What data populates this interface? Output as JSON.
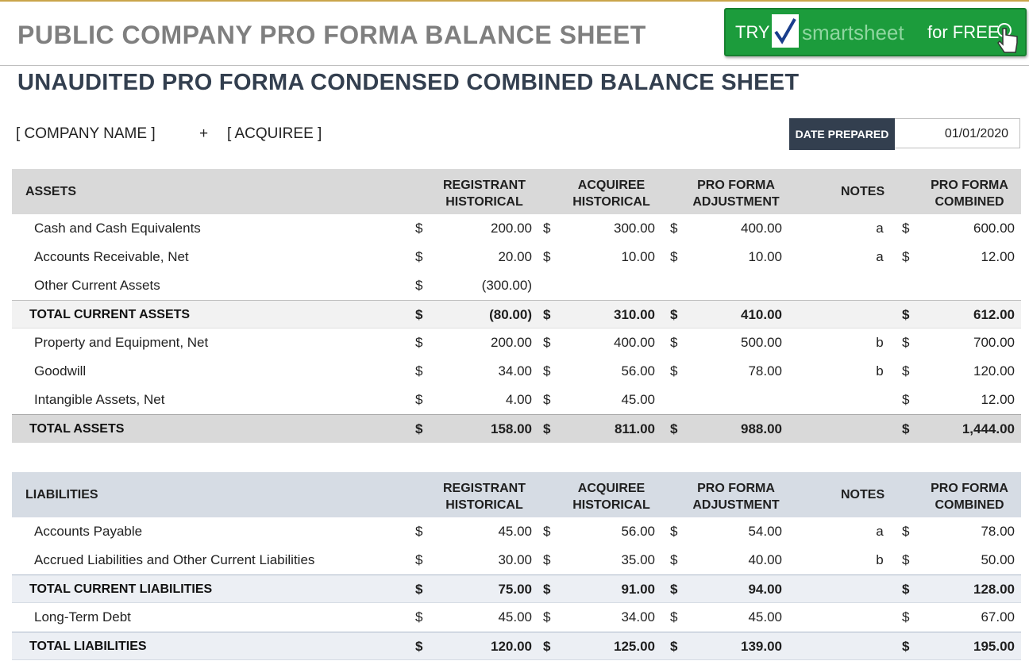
{
  "header": {
    "title": "PUBLIC COMPANY PRO FORMA BALANCE SHEET",
    "cta": {
      "try": "TRY",
      "brand": "smartsheet",
      "for_free": "for FREE"
    }
  },
  "subtitle": "UNAUDITED PRO FORMA CONDENSED COMBINED BALANCE SHEET",
  "company_name": "[ COMPANY NAME ]",
  "plus": "+",
  "acquiree": "[ ACQUIREE ]",
  "date": {
    "label": "DATE PREPARED",
    "value": "01/01/2020"
  },
  "columns": {
    "registrant": [
      "REGISTRANT",
      "HISTORICAL"
    ],
    "acquiree": [
      "ACQUIREE",
      "HISTORICAL"
    ],
    "adjustment": [
      "PRO FORMA",
      "ADJUSTMENT"
    ],
    "notes": "NOTES",
    "combined": [
      "PRO FORMA",
      "COMBINED"
    ]
  },
  "assets": {
    "heading": "ASSETS",
    "rows": [
      {
        "label": "Cash and Cash Equivalents",
        "reg": "200.00",
        "acq": "300.00",
        "adj": "400.00",
        "note": "a",
        "comb": "600.00"
      },
      {
        "label": "Accounts Receivable, Net",
        "reg": "20.00",
        "acq": "10.00",
        "adj": "10.00",
        "note": "a",
        "comb": "12.00"
      },
      {
        "label": "Other Current Assets",
        "reg": "(300.00)",
        "acq": "",
        "adj": "",
        "note": "",
        "comb": ""
      },
      {
        "label": "TOTAL CURRENT ASSETS",
        "reg": "(80.00)",
        "acq": "310.00",
        "adj": "410.00",
        "note": "",
        "comb": "612.00",
        "kind": "total"
      },
      {
        "label": "Property and Equipment, Net",
        "reg": "200.00",
        "acq": "400.00",
        "adj": "500.00",
        "note": "b",
        "comb": "700.00"
      },
      {
        "label": "Goodwill",
        "reg": "34.00",
        "acq": "56.00",
        "adj": "78.00",
        "note": "b",
        "comb": "120.00"
      },
      {
        "label": "Intangible Assets, Net",
        "reg": "4.00",
        "acq": "45.00",
        "adj": "",
        "note": "",
        "comb": "12.00"
      },
      {
        "label": "TOTAL ASSETS",
        "reg": "158.00",
        "acq": "811.00",
        "adj": "988.00",
        "note": "",
        "comb": "1,444.00",
        "kind": "grand"
      }
    ]
  },
  "liabilities": {
    "heading": "LIABILITIES",
    "rows": [
      {
        "label": "Accounts Payable",
        "reg": "45.00",
        "acq": "56.00",
        "adj": "54.00",
        "note": "a",
        "comb": "78.00"
      },
      {
        "label": "Accrued Liabilities and Other Current Liabilities",
        "reg": "30.00",
        "acq": "35.00",
        "adj": "40.00",
        "note": "b",
        "comb": "50.00"
      },
      {
        "label": "TOTAL CURRENT LIABILITIES",
        "reg": "75.00",
        "acq": "91.00",
        "adj": "94.00",
        "note": "",
        "comb": "128.00",
        "kind": "total"
      },
      {
        "label": "Long-Term Debt",
        "reg": "45.00",
        "acq": "34.00",
        "adj": "45.00",
        "note": "",
        "comb": "67.00"
      },
      {
        "label": "TOTAL LIABILITIES",
        "reg": "120.00",
        "acq": "125.00",
        "adj": "139.00",
        "note": "",
        "comb": "195.00",
        "kind": "total"
      }
    ]
  },
  "currency_symbol": "$",
  "colors": {
    "title": "#7f7f7f",
    "subtitle": "#333f4f",
    "cta": "#1c9c3c",
    "assets_header": "#d9d9d9",
    "liabilities_header": "#d6dce4"
  }
}
